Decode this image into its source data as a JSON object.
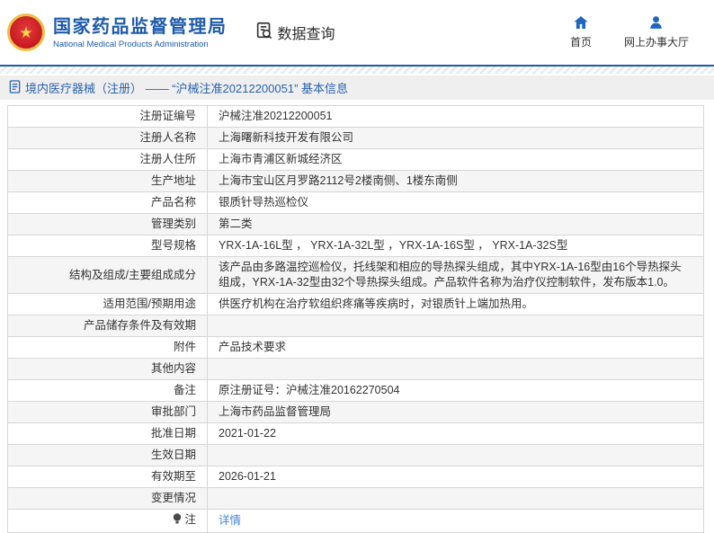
{
  "header": {
    "brand_title": "国家药品监督管理局",
    "brand_subtitle": "National Medical Products Administration",
    "section_label": "数据查询",
    "nav": [
      {
        "label": "首页"
      },
      {
        "label": "网上办事大厅"
      }
    ]
  },
  "breadcrumb": {
    "title": "境内医疗器械（注册） —— “沪械注准20212200051” 基本信息"
  },
  "table": {
    "rows": [
      {
        "label": "注册证编号",
        "value": "沪械注准20212200051"
      },
      {
        "label": "注册人名称",
        "value": "上海曙新科技开发有限公司"
      },
      {
        "label": "注册人住所",
        "value": "上海市青浦区新城经济区"
      },
      {
        "label": "生产地址",
        "value": "上海市宝山区月罗路2112号2楼南侧、1楼东南侧"
      },
      {
        "label": "产品名称",
        "value": "银质针导热巡检仪"
      },
      {
        "label": "管理类别",
        "value": "第二类"
      },
      {
        "label": "型号规格",
        "value": "YRX-1A-16L型 ， YRX-1A-32L型 ，YRX-1A-16S型 ， YRX-1A-32S型"
      },
      {
        "label": "结构及组成/主要组成成分",
        "value": "该产品由多路温控巡检仪，托线架和相应的导热探头组成，其中YRX-1A-16型由16个导热探头组成，YRX-1A-32型由32个导热探头组成。产品软件名称为治疗仪控制软件，发布版本1.0。"
      },
      {
        "label": "适用范围/预期用途",
        "value": "供医疗机构在治疗软组织疼痛等疾病时，对银质针上端加热用。"
      },
      {
        "label": "产品储存条件及有效期",
        "value": ""
      },
      {
        "label": "附件",
        "value": "产品技术要求"
      },
      {
        "label": "其他内容",
        "value": ""
      },
      {
        "label": "备注",
        "value": "原注册证号：沪械注准20162270504"
      },
      {
        "label": "审批部门",
        "value": "上海市药品监督管理局"
      },
      {
        "label": "批准日期",
        "value": "2021-01-22"
      },
      {
        "label": "生效日期",
        "value": ""
      },
      {
        "label": "有效期至",
        "value": "2026-01-21"
      },
      {
        "label": "变更情况",
        "value": ""
      },
      {
        "label": "注",
        "value": "详情",
        "link": true,
        "icon": "lightbulb"
      }
    ]
  },
  "colors": {
    "accent_blue": "#1e5bab",
    "header_rule_blue": "#1a5dab",
    "link_blue": "#4086d8",
    "emblem_red": "#c6191f",
    "emblem_gold": "#eec04a",
    "bar_gray": "#efefef",
    "row_alt_gray": "#f5f5f6"
  }
}
